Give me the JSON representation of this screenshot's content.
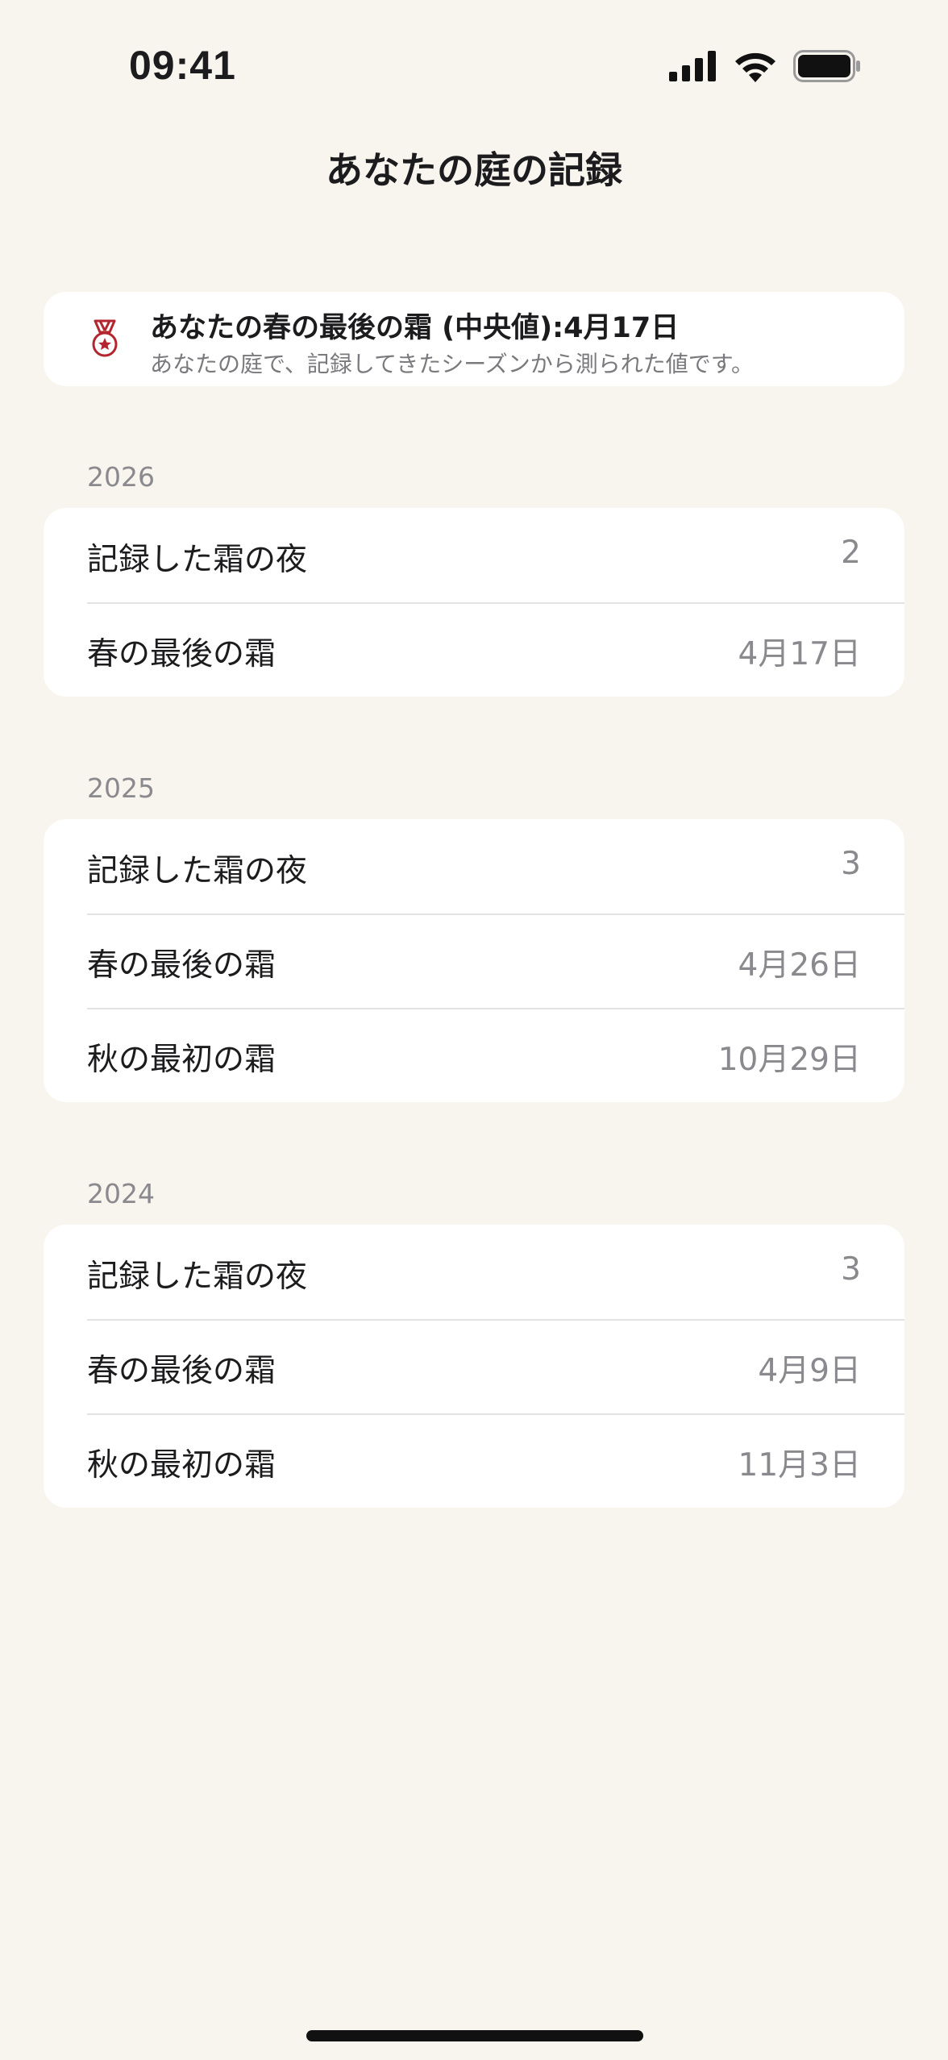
{
  "status_bar": {
    "time": "09:41"
  },
  "header": {
    "title": "あなたの庭の記録"
  },
  "summary": {
    "icon": "medal-icon",
    "accent_color": "#b3262f",
    "title": "あなたの春の最後の霜 (中央値):4月17日",
    "subtitle": "あなたの庭で、記録してきたシーズンから測られた値です。"
  },
  "seasons": [
    {
      "year": "2026",
      "rows": [
        {
          "label": "記録した霜の夜",
          "value": "2"
        },
        {
          "label": "春の最後の霜",
          "value": "4月17日"
        }
      ]
    },
    {
      "year": "2025",
      "rows": [
        {
          "label": "記録した霜の夜",
          "value": "3"
        },
        {
          "label": "春の最後の霜",
          "value": "4月26日"
        },
        {
          "label": "秋の最初の霜",
          "value": "10月29日"
        }
      ]
    },
    {
      "year": "2024",
      "rows": [
        {
          "label": "記録した霜の夜",
          "value": "3"
        },
        {
          "label": "春の最後の霜",
          "value": "4月9日"
        },
        {
          "label": "秋の最初の霜",
          "value": "11月3日"
        }
      ]
    }
  ]
}
